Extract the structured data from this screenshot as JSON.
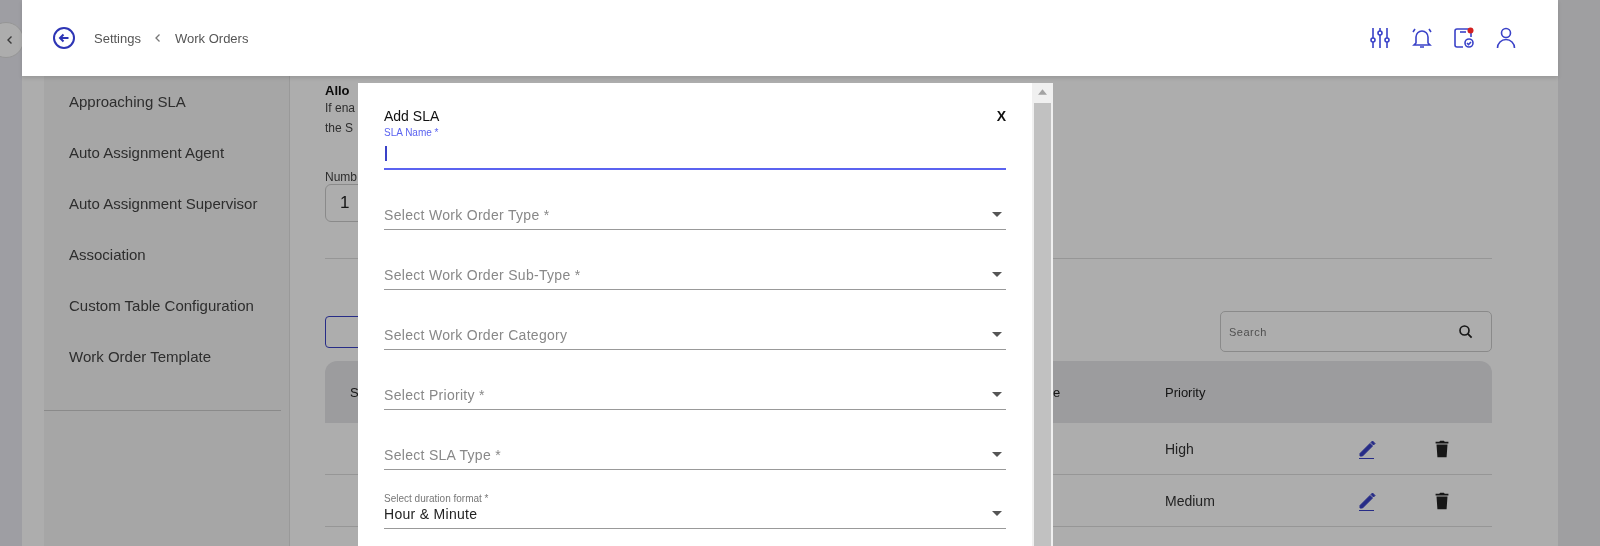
{
  "header": {
    "breadcrumb": [
      "Settings",
      "Work Orders"
    ],
    "notification_dot": true
  },
  "sidebar": {
    "items": [
      {
        "label": "Approaching SLA"
      },
      {
        "label": "Auto Assignment Agent"
      },
      {
        "label": "Auto Assignment Supervisor"
      },
      {
        "label": "Association"
      },
      {
        "label": "Custom Table Configuration"
      },
      {
        "label": "Work Order Template"
      }
    ]
  },
  "content": {
    "setting_title": "Allo",
    "setting_desc": [
      "If ena",
      "the S"
    ],
    "number_label": "Numb",
    "number_value": "1"
  },
  "table": {
    "search": {
      "placeholder": "Search"
    },
    "columns": [
      "S",
      "e",
      "Priority"
    ],
    "rows": [
      {
        "priority": "High"
      },
      {
        "priority": "Medium"
      }
    ]
  },
  "modal": {
    "title": "Add SLA",
    "close": "X",
    "name_field": {
      "label": "SLA Name *",
      "focused": true
    },
    "fields": [
      {
        "placeholder": "Select Work Order Type *"
      },
      {
        "placeholder": "Select Work Order Sub-Type *"
      },
      {
        "placeholder": "Select Work Order Category"
      },
      {
        "placeholder": "Select Priority *"
      },
      {
        "placeholder": "Select SLA Type *"
      },
      {
        "label": "Select duration format *",
        "value": "Hour & Minute"
      }
    ]
  }
}
